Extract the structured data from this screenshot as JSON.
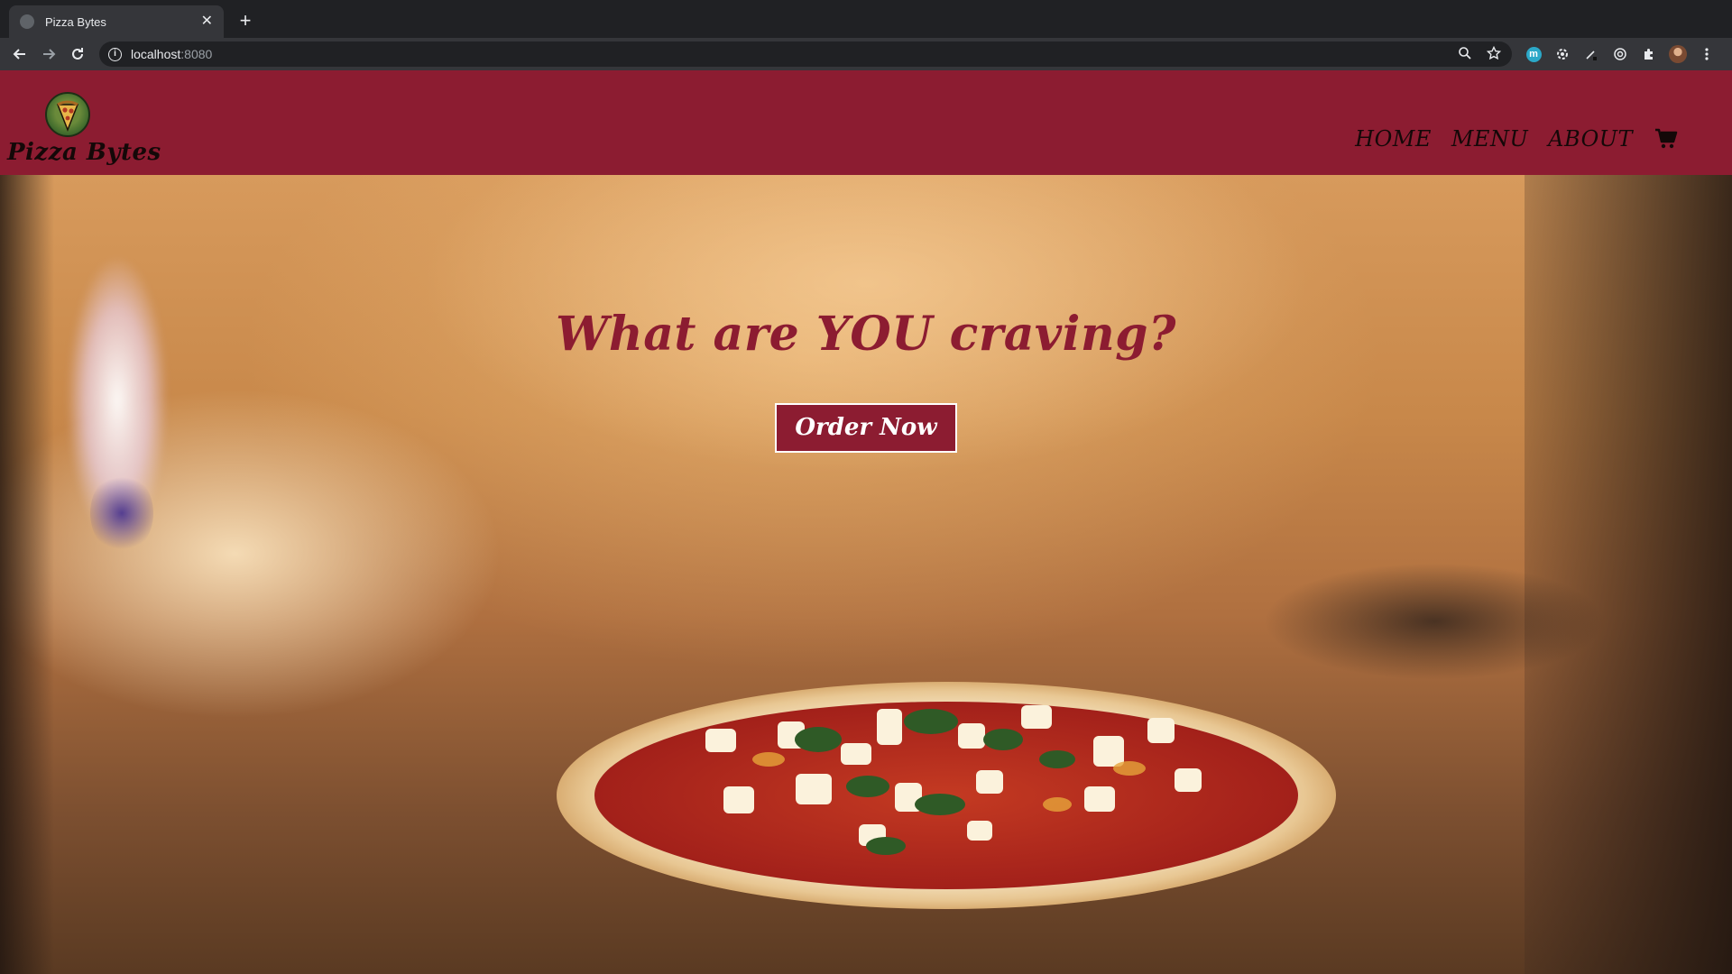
{
  "browser": {
    "tab_title": "Pizza Bytes",
    "url_host": "localhost",
    "url_port": ":8080"
  },
  "site": {
    "brand_name": "Pizza Bytes",
    "nav": {
      "home": "HOME",
      "menu": "MENU",
      "about": "ABOUT"
    }
  },
  "hero": {
    "title": "What are YOU craving?",
    "cta_label": "Order Now"
  },
  "colors": {
    "brand_primary": "#8c1c31",
    "button_text": "#ffffff",
    "nav_text": "#140808"
  },
  "icons": {
    "cart": "shopping-cart-icon",
    "logo": "pizza-logo-icon"
  }
}
